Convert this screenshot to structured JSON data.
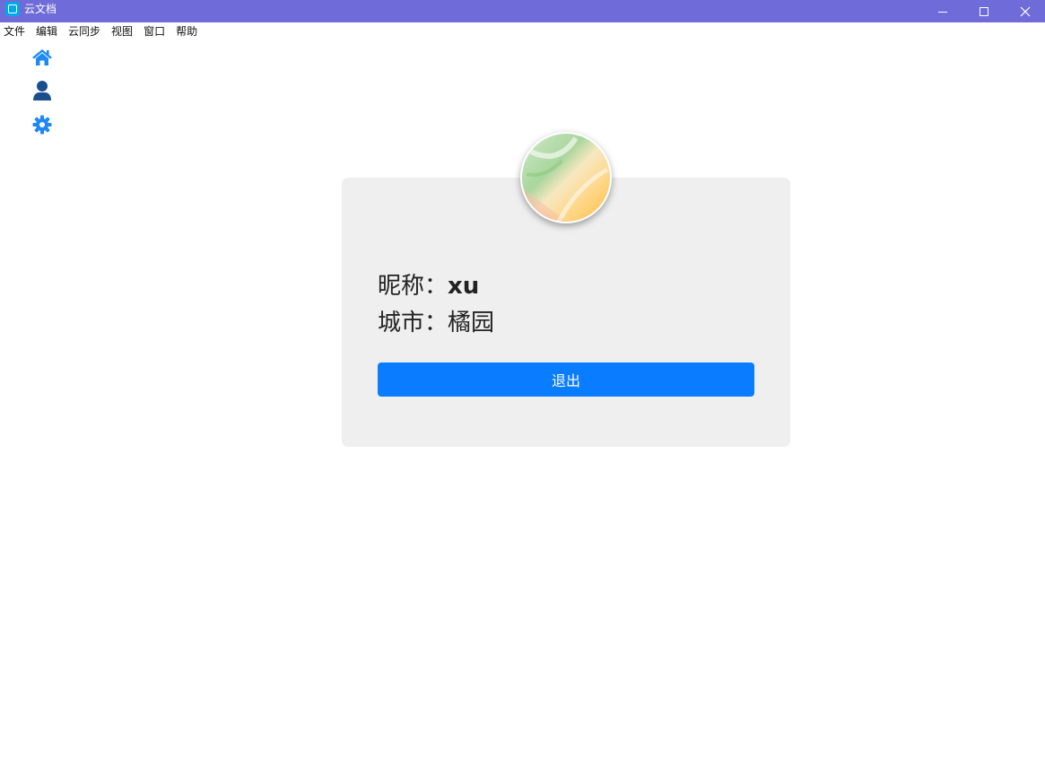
{
  "window": {
    "title": "云文档",
    "titlebar_color": "#6f6bd8",
    "controls": [
      "minimize-icon",
      "maximize-icon",
      "close-icon"
    ]
  },
  "menu": {
    "items": [
      "文件",
      "编辑",
      "云同步",
      "视图",
      "窗口",
      "帮助"
    ]
  },
  "sidebar": {
    "items": [
      {
        "icon": "home-icon",
        "color": "#1e88f5"
      },
      {
        "icon": "user-icon",
        "color": "#1a4f8f"
      },
      {
        "icon": "gear-icon",
        "color": "#1e88f5"
      }
    ]
  },
  "profile": {
    "card_bg": "#efefef",
    "nickname_label": "昵称：",
    "nickname_value": "xu",
    "city_label": "城市：",
    "city_value": "橘园",
    "logout_label": "退出",
    "logout_color": "#0a7cff"
  }
}
